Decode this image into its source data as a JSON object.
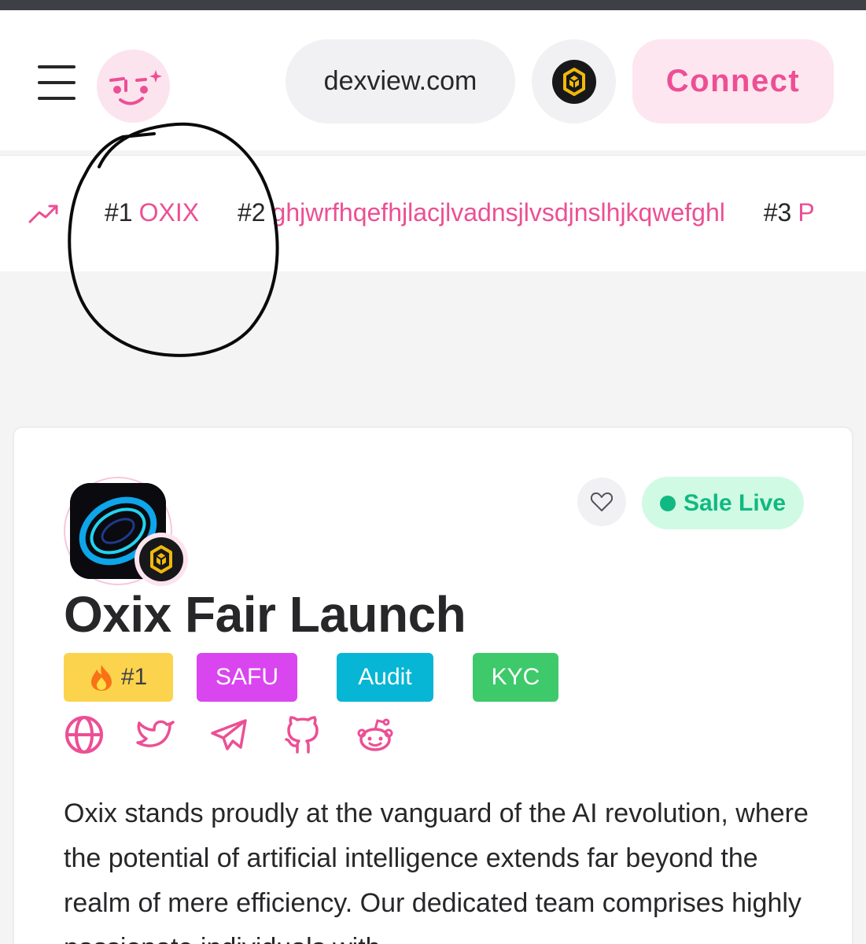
{
  "header": {
    "domain": "dexview.com",
    "connect_label": "Connect"
  },
  "trending": {
    "items": [
      {
        "rank": "#1",
        "name": "OXIX"
      },
      {
        "rank": "#2",
        "name": "ghjwrfhqefhjlacjlvadnsjlvsdjnslhjkqwefghl"
      },
      {
        "rank": "#3",
        "name": "P"
      }
    ]
  },
  "project": {
    "title": "Oxix Fair Launch",
    "status": "Sale Live",
    "badges": {
      "rank": "#1",
      "safu": "SAFU",
      "audit": "Audit",
      "kyc": "KYC"
    },
    "socials": [
      "globe-icon",
      "twitter-icon",
      "telegram-icon",
      "github-icon",
      "reddit-icon"
    ],
    "description": "Oxix stands proudly at the vanguard of the AI revolution, where the potential of artificial intelligence extends far beyond the realm of mere efficiency. Our dedicated team comprises highly passionate individuals with"
  },
  "colors": {
    "accent": "#ec4f94",
    "status_green": "#10b981",
    "chain_gold": "#f0b90b"
  }
}
